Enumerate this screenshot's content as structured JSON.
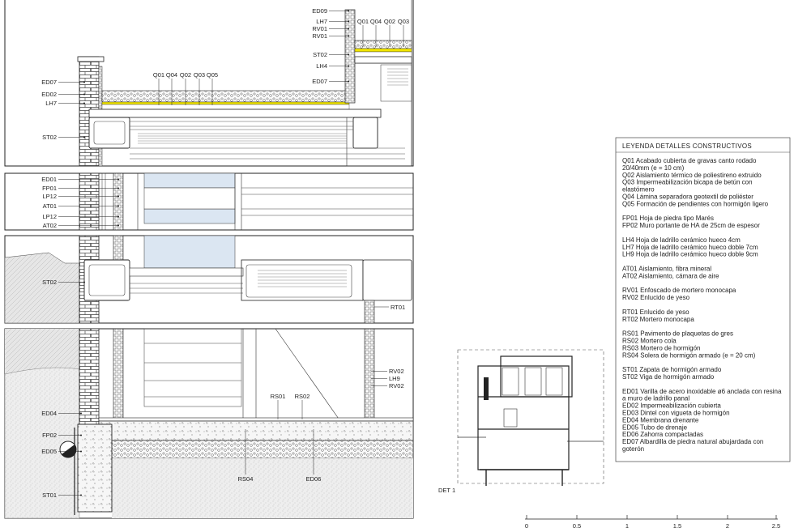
{
  "details": {
    "roof_upper": {
      "left_labels": [
        "ED09",
        "LH7",
        "RV01",
        "RV01",
        "ST02",
        "LH4",
        "ED07"
      ],
      "top_labels": [
        "Q01",
        "Q04",
        "Q02",
        "Q03"
      ]
    },
    "roof_main": {
      "left_labels": [
        "ED07",
        "ED02",
        "LH7",
        "ST02"
      ],
      "top_labels": [
        "Q01",
        "Q04",
        "Q02",
        "Q03",
        "Q05"
      ]
    },
    "wall": {
      "left_labels": [
        "ED01",
        "FP01",
        "LP12",
        "AT01",
        "LP12",
        "AT02"
      ]
    },
    "floor": {
      "left_labels": [
        "ST02"
      ],
      "right_label": "RT01"
    },
    "foundation": {
      "left_labels": [
        "ED04",
        "FP02",
        "ED05",
        "ST01"
      ],
      "right_labels": [
        "RV02",
        "LH9",
        "RV02"
      ],
      "top_labels": [
        "RS01",
        "RS02"
      ],
      "bottom_labels": [
        "RS04",
        "ED06"
      ]
    }
  },
  "legend": {
    "title": "LEYENDA  DETALLES  CONSTRUCTIVOS",
    "lines": [
      "Q01  Acabado cubierta de gravas canto rodado",
      "20/40mm (e = 10 cm)",
      "Q02  Aislamiento térmico de poliestireno extruido",
      "Q03  Impermeabilización bicapa de betún con",
      "elastómero",
      "Q04  Lámina separadora geotextil de poliéster",
      "Q05  Formación de pendientes con hormigón ligero",
      "",
      "FP01  Hoja de piedra tipo Marés",
      "FP02  Muro portante de HA de 25cm de espesor",
      "",
      "LH4    Hoja de ladrillo cerámico hueco 4cm",
      "LH7    Hoja de ladrillo cerámico hueco doble 7cm",
      "LH9    Hoja de ladrillo cerámico hueco doble 9cm",
      "",
      "AT01  Aislamiento, fibra mineral",
      "AT02 Aislamiento, cámara de aire",
      "",
      "RV01  Enfoscado de mortero monocapa",
      "RV02  Enlucido de yeso",
      "",
      "RT01 Enlucido de yeso",
      "RT02 Mortero monocapa",
      "",
      "RS01  Pavimento de plaquetas de gres",
      "RS02  Mortero cola",
      "RS03  Mortero de hormigón",
      "RS04  Solera de hormigón armado (e = 20 cm)",
      "",
      "ST01 Zapata de hormigón armado",
      "ST02 Viga de hormigón armado",
      "",
      "ED01  Varilla de acero inoxidable ø6 anclada con resina",
      "a muro de ladrillo panal",
      "ED02  Impermeabilización cubierta",
      "ED03  Dintel con vigueta de hormigón",
      "ED04  Membrana drenante",
      "ED05  Tubo de drenaje",
      "ED06  Zahorra compactadas",
      "ED07  Albardilla de piedra natural abujardada con",
      "goterón"
    ]
  },
  "key_plan": {
    "label": "DET 1"
  },
  "scale_bar": {
    "ticks": [
      "0",
      "0.5",
      "1",
      "1.5",
      "2",
      "2.5"
    ],
    "values": [
      0,
      0.5,
      1,
      1.5,
      2,
      2.5
    ]
  },
  "colors": {
    "line": "#222222",
    "glass": "#dbe6f2",
    "waterproofing": "#f2e600",
    "insulation": "#ffffff",
    "gravel": "#f4f4f4"
  }
}
